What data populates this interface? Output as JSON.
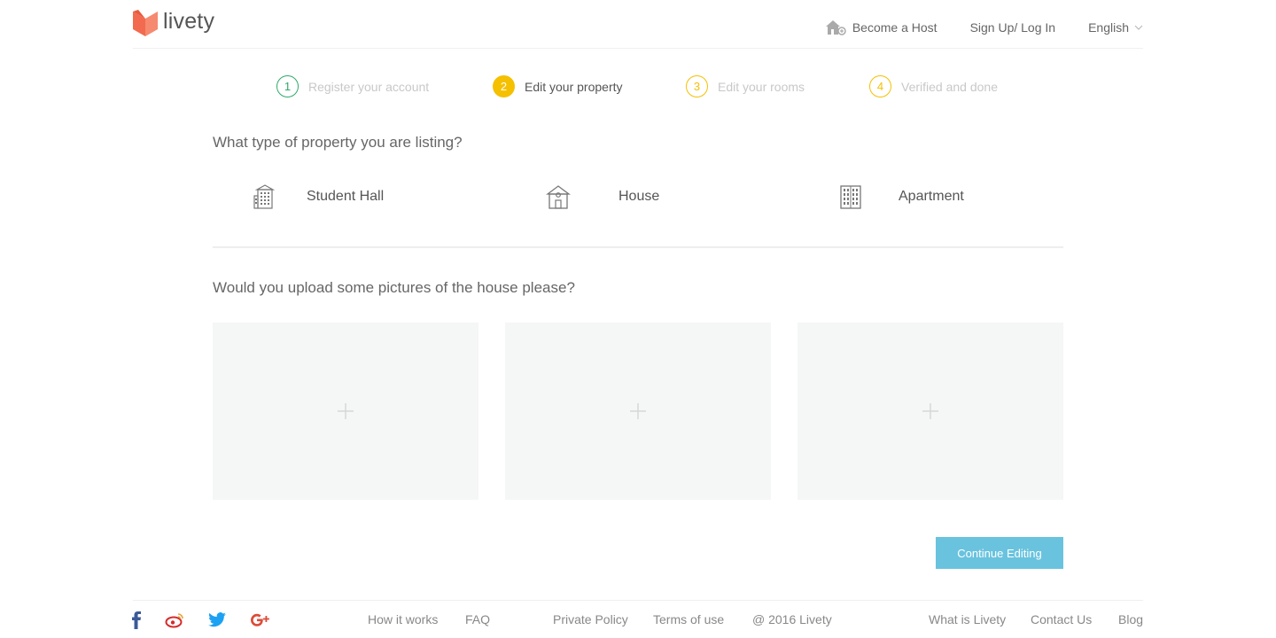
{
  "header": {
    "brand": "livety",
    "nav": {
      "become_host": "Become a Host",
      "signup": "Sign Up/ Log In",
      "language": "English"
    }
  },
  "steps": [
    {
      "number": "1",
      "label": "Register your account",
      "state": "done",
      "color": "#2eaa6a"
    },
    {
      "number": "2",
      "label": "Edit your property",
      "state": "current",
      "color": "#f5c000"
    },
    {
      "number": "3",
      "label": "Edit your rooms",
      "state": "pending",
      "color": "#f5c000"
    },
    {
      "number": "4",
      "label": "Verified and done",
      "state": "pending",
      "color": "#f5c000"
    }
  ],
  "property_type": {
    "question": "What type of property you are listing?",
    "options": [
      {
        "label": "Student Hall",
        "icon": "student-hall-icon"
      },
      {
        "label": "House",
        "icon": "house-icon"
      },
      {
        "label": "Apartment",
        "icon": "apartment-icon"
      }
    ]
  },
  "upload": {
    "question": "Would you upload some pictures of the house please?",
    "slots": [
      {
        "icon": "plus-icon"
      },
      {
        "icon": "plus-icon"
      },
      {
        "icon": "plus-icon"
      }
    ]
  },
  "actions": {
    "continue_label": "Continue Editing",
    "continue_color": "#69c3de"
  },
  "footer": {
    "social": [
      {
        "name": "facebook-icon",
        "color": "#3b5998"
      },
      {
        "name": "weibo-icon",
        "color": "#d52b2b"
      },
      {
        "name": "twitter-icon",
        "color": "#1da1f2"
      },
      {
        "name": "google-plus-icon",
        "color": "#dd4b39"
      }
    ],
    "links": {
      "how": "How it works",
      "faq": "FAQ",
      "privacy": "Private Policy",
      "terms": "Terms of use",
      "copyright": "@ 2016 Livety",
      "what": "What is Livety",
      "contact": "Contact Us",
      "blog": "Blog"
    }
  },
  "colors": {
    "brand": "#f26a4f",
    "step_done": "#2eaa6a",
    "step_active": "#f5c000"
  }
}
